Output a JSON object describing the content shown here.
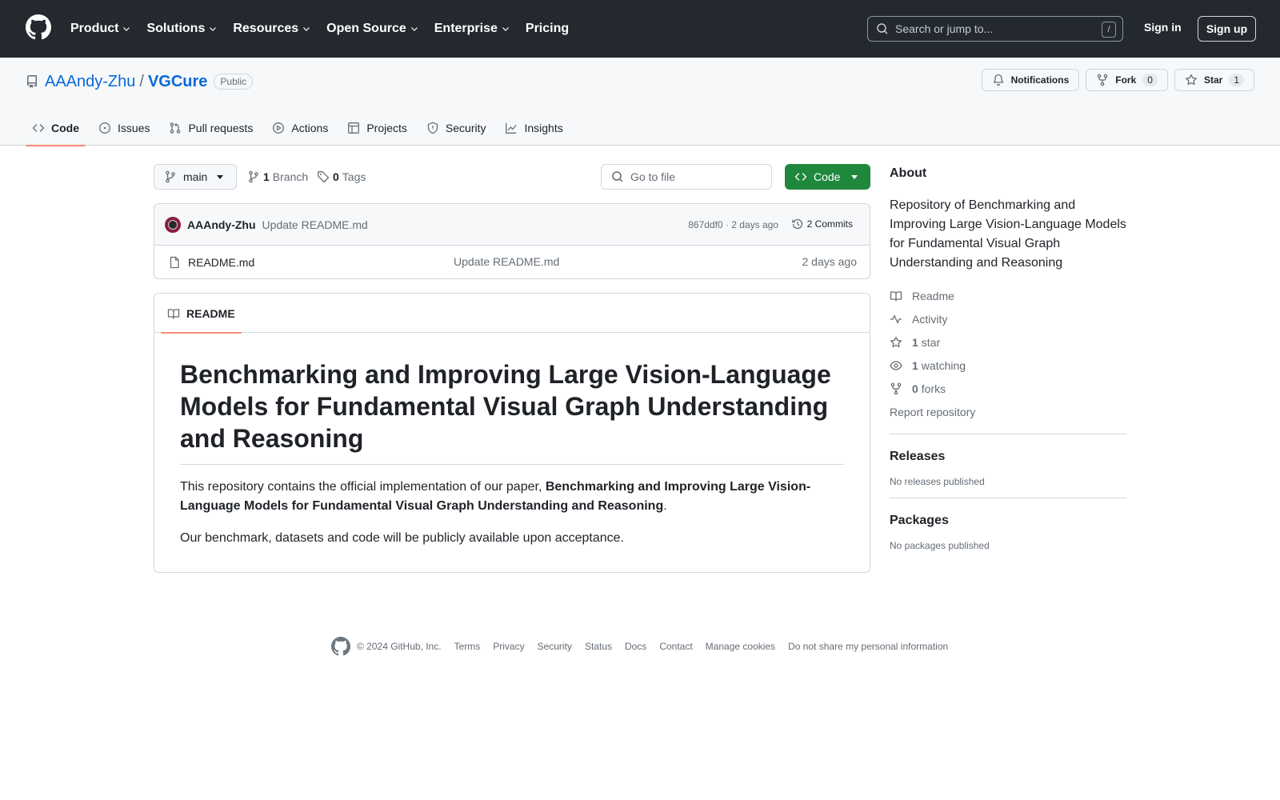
{
  "header": {
    "nav": [
      {
        "label": "Product",
        "dropdown": true
      },
      {
        "label": "Solutions",
        "dropdown": true
      },
      {
        "label": "Resources",
        "dropdown": true
      },
      {
        "label": "Open Source",
        "dropdown": true
      },
      {
        "label": "Enterprise",
        "dropdown": true
      },
      {
        "label": "Pricing",
        "dropdown": false
      }
    ],
    "search_placeholder": "Search or jump to...",
    "search_shortcut": "/",
    "signin": "Sign in",
    "signup": "Sign up"
  },
  "repo": {
    "owner": "AAAndy-Zhu",
    "separator": "/",
    "name": "VGCure",
    "visibility": "Public",
    "actions": {
      "notifications": "Notifications",
      "fork_label": "Fork",
      "fork_count": "0",
      "star_label": "Star",
      "star_count": "1"
    },
    "tabs": [
      {
        "label": "Code",
        "icon": "code-icon",
        "active": true
      },
      {
        "label": "Issues",
        "icon": "issue-icon",
        "active": false
      },
      {
        "label": "Pull requests",
        "icon": "pull-request-icon",
        "active": false
      },
      {
        "label": "Actions",
        "icon": "play-icon",
        "active": false
      },
      {
        "label": "Projects",
        "icon": "table-icon",
        "active": false
      },
      {
        "label": "Security",
        "icon": "shield-icon",
        "active": false
      },
      {
        "label": "Insights",
        "icon": "graph-icon",
        "active": false
      }
    ]
  },
  "toolbar": {
    "branch": "main",
    "branch_count": "1",
    "branch_label": "Branch",
    "tag_count": "0",
    "tag_label": "Tags",
    "goto_placeholder": "Go to file",
    "code_button": "Code"
  },
  "latest_commit": {
    "author": "AAAndy-Zhu",
    "message": "Update README.md",
    "hash_and_time": "867ddf0 · 2 days ago",
    "commits": "2 Commits"
  },
  "files": [
    {
      "name": "README.md",
      "message": "Update README.md",
      "age": "2 days ago"
    }
  ],
  "readme": {
    "tab": "README",
    "title": "Benchmarking and Improving Large Vision-Language Models for Fundamental Visual Graph Understanding and Reasoning",
    "p1_prefix": "This repository contains the official implementation of our paper, ",
    "p1_bold": "Benchmarking and Improving Large Vision-Language Models for Fundamental Visual Graph Understanding and Reasoning",
    "p1_suffix": ".",
    "p2": "Our benchmark, datasets and code will be publicly available upon acceptance."
  },
  "about": {
    "heading": "About",
    "description": "Repository of Benchmarking and Improving Large Vision-Language Models for Fundamental Visual Graph Understanding and Reasoning",
    "readme": "Readme",
    "activity": "Activity",
    "stars_count": "1",
    "stars_label": "star",
    "watching_count": "1",
    "watching_label": "watching",
    "forks_count": "0",
    "forks_label": "forks",
    "report": "Report repository"
  },
  "releases": {
    "heading": "Releases",
    "empty": "No releases published"
  },
  "packages": {
    "heading": "Packages",
    "empty": "No packages published"
  },
  "footer": {
    "copyright": "© 2024 GitHub, Inc.",
    "links": [
      "Terms",
      "Privacy",
      "Security",
      "Status",
      "Docs",
      "Contact",
      "Manage cookies",
      "Do not share my personal information"
    ]
  },
  "colors": {
    "header_bg": "#24292f",
    "link": "#0969da",
    "code_button": "#1f883d",
    "active_tab_underline": "#fd8c73"
  }
}
